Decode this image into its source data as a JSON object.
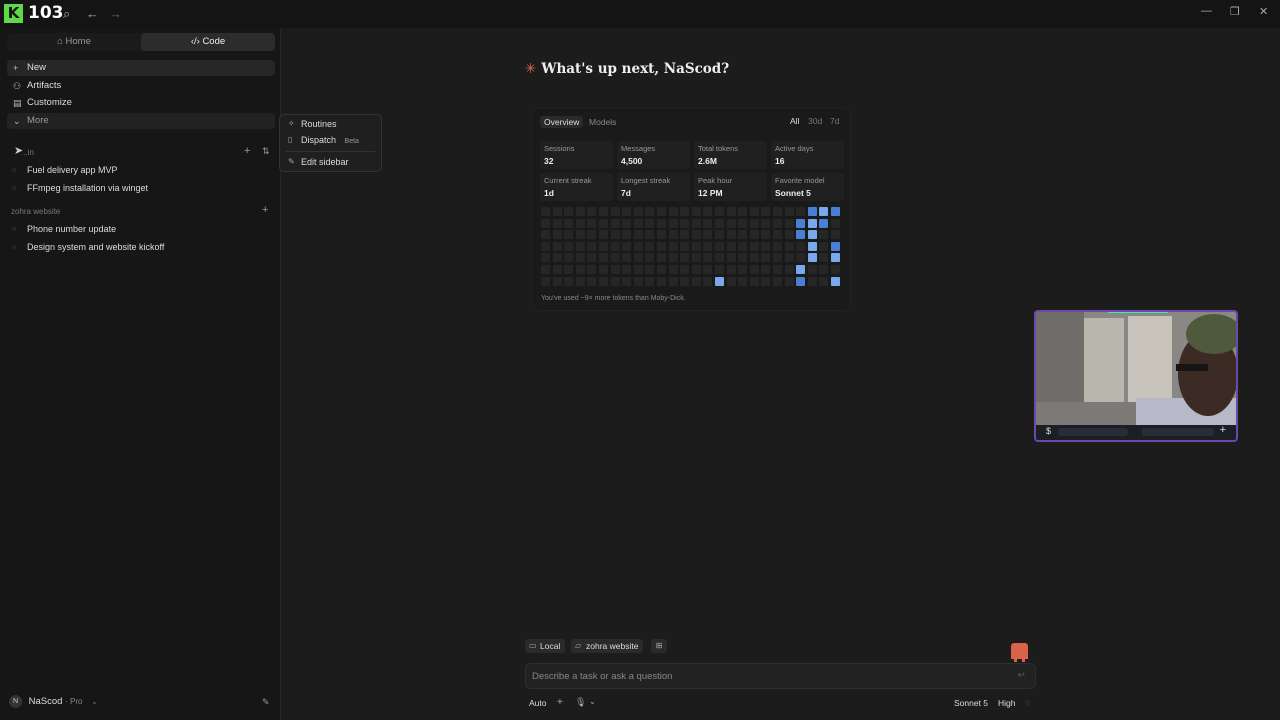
{
  "topbar": {
    "logo_letter": "K",
    "logo_number": "103"
  },
  "sidebar": {
    "tabs": [
      {
        "label": "Home",
        "icon": "house-icon",
        "active": false
      },
      {
        "label": "Code",
        "icon": "code-icon",
        "active": true
      }
    ],
    "nav": [
      {
        "label": "New",
        "icon": "plus-icon"
      },
      {
        "label": "Artifacts",
        "icon": "artifacts-icon"
      },
      {
        "label": "Customize",
        "icon": "briefcase-icon"
      },
      {
        "label": "More",
        "icon": "chevron-down-icon"
      }
    ],
    "section1": {
      "label": "...in",
      "threads": [
        "Fuel delivery app MVP",
        "FFmpeg installation via winget"
      ]
    },
    "section2": {
      "label": "zohra website",
      "threads": [
        "Phone number update",
        "Design system and website kickoff"
      ]
    },
    "user": {
      "initial": "N",
      "name": "NaScod",
      "plan": "· Pro"
    }
  },
  "popup": {
    "items": [
      {
        "label": "Routines",
        "icon": "routines-icon"
      },
      {
        "label": "Dispatch",
        "icon": "phone-icon",
        "badge": "Beta"
      },
      {
        "label": "Edit sidebar",
        "icon": "pencil-icon"
      }
    ]
  },
  "main": {
    "greeting": "What's up next, NaScod?",
    "stats": {
      "tabs": [
        "Overview",
        "Models"
      ],
      "ranges": [
        "All",
        "30d",
        "7d"
      ],
      "cards": [
        {
          "label": "Sessions",
          "value": "32"
        },
        {
          "label": "Messages",
          "value": "4,500"
        },
        {
          "label": "Total tokens",
          "value": "2.6M"
        },
        {
          "label": "Active days",
          "value": "16"
        },
        {
          "label": "Current streak",
          "value": "1d"
        },
        {
          "label": "Longest streak",
          "value": "7d"
        },
        {
          "label": "Peak hour",
          "value": "12 PM"
        },
        {
          "label": "Favorite model",
          "value": "Sonnet 5"
        }
      ],
      "heatmap_active": [
        [
          23,
          0,
          "#4a7fd6"
        ],
        [
          24,
          0,
          "#7aa8ec"
        ],
        [
          25,
          0,
          "#4a7fd6"
        ],
        [
          23,
          1,
          "#7aa8ec"
        ],
        [
          24,
          1,
          "#4a7fd6"
        ],
        [
          22,
          1,
          "#4a7fd6"
        ],
        [
          22,
          2,
          "#4a7fd6"
        ],
        [
          23,
          2,
          "#7aa8ec"
        ],
        [
          23,
          3,
          "#7aa8ec"
        ],
        [
          25,
          3,
          "#4a7fd6"
        ],
        [
          23,
          4,
          "#7aa8ec"
        ],
        [
          25,
          4,
          "#7aa8ec"
        ],
        [
          22,
          5,
          "#7aa8ec"
        ],
        [
          15,
          6,
          "#7aa8ec"
        ],
        [
          22,
          6,
          "#4a7fd6"
        ],
        [
          25,
          6,
          "#7aa8ec"
        ]
      ],
      "note": "You've used ~9× more tokens than Moby-Dick."
    },
    "composer": {
      "chips": [
        {
          "label": "Local",
          "icon": "laptop-icon"
        },
        {
          "label": "zohra website",
          "icon": "folder-icon"
        }
      ],
      "placeholder": "Describe a task or ask a question",
      "mode": "Auto",
      "model": "Sonnet 5",
      "effort": "High"
    }
  },
  "colors": {
    "accent": "#e06a4a",
    "logo": "#5fd84a",
    "heat_dark": "#4a7fd6",
    "heat_light": "#7aa8ec"
  }
}
